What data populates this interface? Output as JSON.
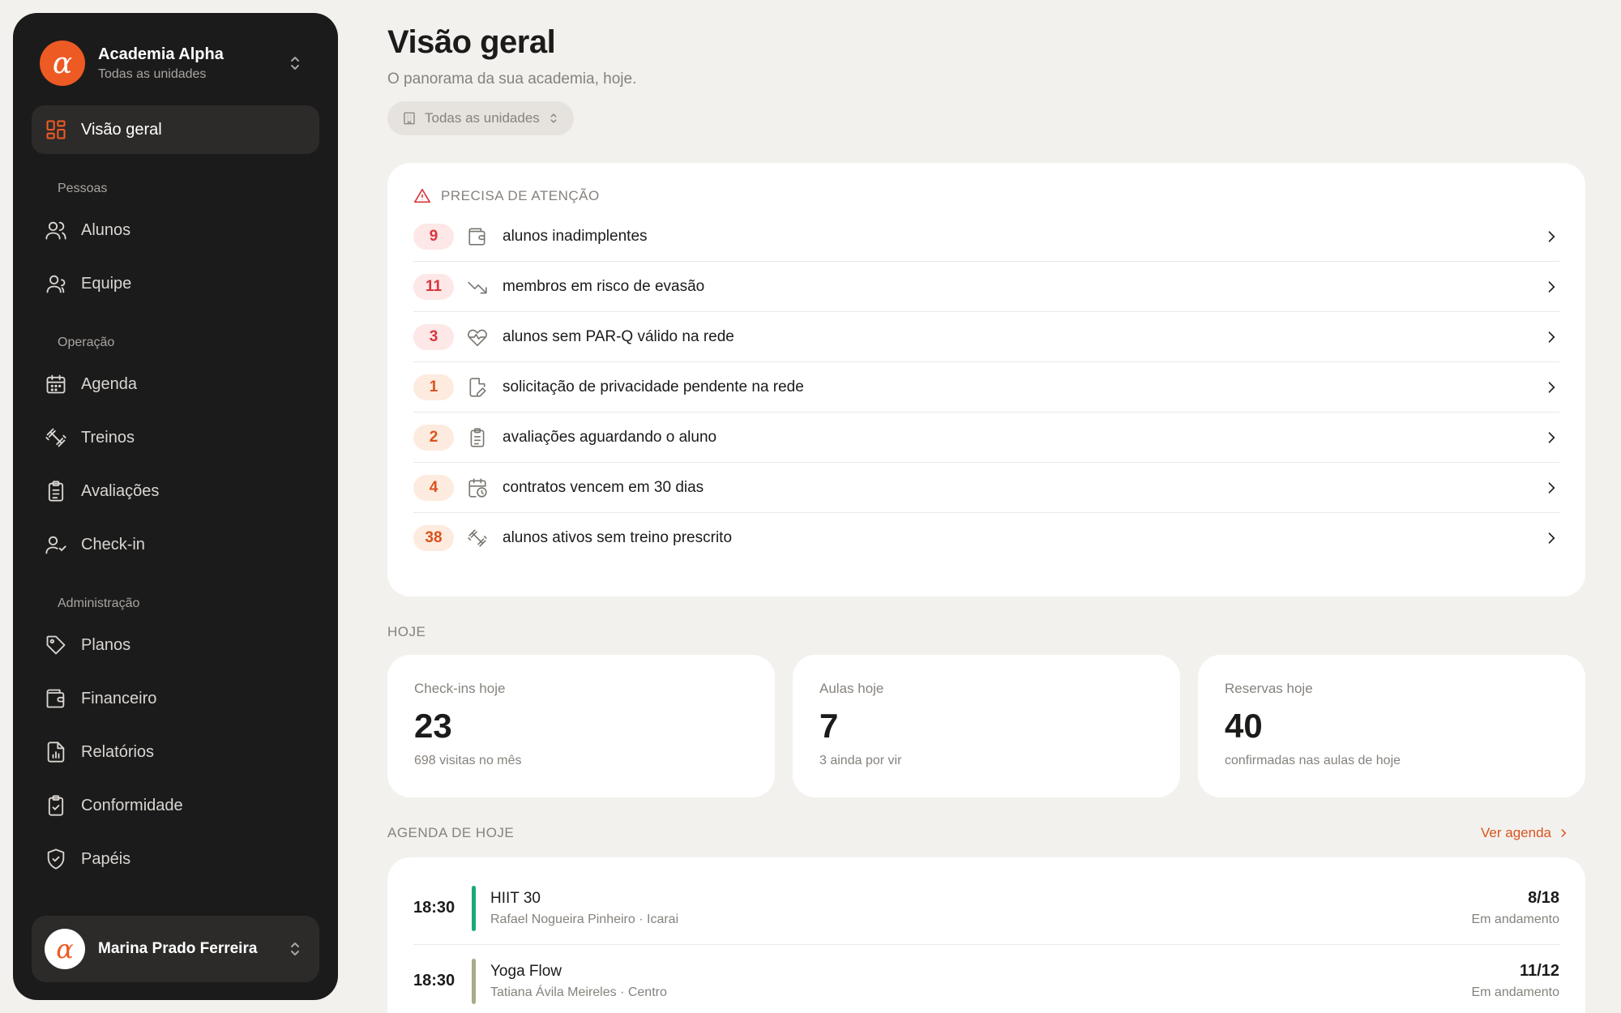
{
  "brand": {
    "name": "Academia Alpha",
    "subtitle": "Todas as unidades",
    "logo_letter": "α",
    "color": "#ee5a24"
  },
  "nav": {
    "overview": "Visão geral",
    "sections": {
      "people": "Pessoas",
      "operation": "Operação",
      "admin": "Administração"
    },
    "people_items": [
      "Alunos",
      "Equipe"
    ],
    "operation_items": [
      "Agenda",
      "Treinos",
      "Avaliações",
      "Check-in"
    ],
    "admin_items": [
      "Planos",
      "Financeiro",
      "Relatórios",
      "Conformidade",
      "Papéis"
    ]
  },
  "user": {
    "name": "Marina Prado Ferreira",
    "avatar_letter": "α"
  },
  "page": {
    "title": "Visão geral",
    "subtitle": "O panorama da sua academia, hoje.",
    "unit_selector": "Todas as unidades"
  },
  "attention": {
    "title": "PRECISA DE ATENÇÃO",
    "items": [
      {
        "count": "9",
        "text": "alunos inadimplentes",
        "tone": "red",
        "icon": "wallet-icon"
      },
      {
        "count": "11",
        "text": "membros em risco de evasão",
        "tone": "red",
        "icon": "trending-down-icon"
      },
      {
        "count": "3",
        "text": "alunos sem PAR-Q válido na rede",
        "tone": "red",
        "icon": "heart-pulse-icon"
      },
      {
        "count": "1",
        "text": "solicitação de privacidade pendente na rede",
        "tone": "orange",
        "icon": "file-edit-icon"
      },
      {
        "count": "2",
        "text": "avaliações aguardando o aluno",
        "tone": "orange",
        "icon": "clipboard-icon"
      },
      {
        "count": "4",
        "text": "contratos vencem em 30 dias",
        "tone": "orange",
        "icon": "calendar-clock-icon"
      },
      {
        "count": "38",
        "text": "alunos ativos sem treino prescrito",
        "tone": "orange",
        "icon": "dumbbell-icon"
      }
    ]
  },
  "today": {
    "label": "HOJE",
    "stats": [
      {
        "label": "Check-ins hoje",
        "value": "23",
        "sub": "698 visitas no mês"
      },
      {
        "label": "Aulas hoje",
        "value": "7",
        "sub": "3 ainda por vir"
      },
      {
        "label": "Reservas hoje",
        "value": "40",
        "sub": "confirmadas nas aulas de hoje"
      }
    ]
  },
  "agenda": {
    "label": "AGENDA DE HOJE",
    "link": "Ver agenda",
    "items": [
      {
        "time": "18:30",
        "name": "HIIT 30",
        "teacher": "Rafael Nogueira Pinheiro · Icarai",
        "count": "8/18",
        "status": "Em andamento",
        "color": "#1aa87a"
      },
      {
        "time": "18:30",
        "name": "Yoga Flow",
        "teacher": "Tatiana Ávila Meireles · Centro",
        "count": "11/12",
        "status": "Em andamento",
        "color": "#a9ab8a"
      }
    ]
  }
}
